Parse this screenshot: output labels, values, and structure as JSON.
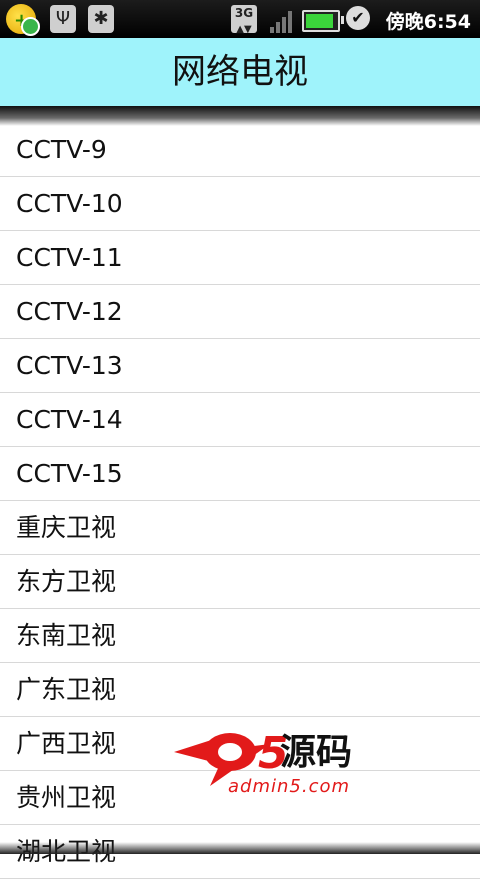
{
  "status_bar": {
    "clock": "傍晚6:54",
    "network_type": "3G",
    "battery_level": 0.9,
    "icons": [
      "app-notification-icon",
      "usb-icon",
      "debug-bug-icon",
      "network-3g-icon",
      "signal-icon",
      "battery-icon",
      "alarm-icon"
    ]
  },
  "header": {
    "title": "网络电视"
  },
  "channels": [
    "CCTV-9",
    "CCTV-10",
    "CCTV-11",
    "CCTV-12",
    "CCTV-13",
    "CCTV-14",
    "CCTV-15",
    "重庆卫视",
    "东方卫视",
    "东南卫视",
    "广东卫视",
    "广西卫视",
    "贵州卫视",
    "湖北卫视"
  ],
  "watermark": {
    "brand": "a5源码",
    "url": "admin5.com"
  },
  "colors": {
    "header_bg": "#9ff3fb",
    "divider": "#d8d8d8",
    "watermark_red": "#e21a1a"
  }
}
